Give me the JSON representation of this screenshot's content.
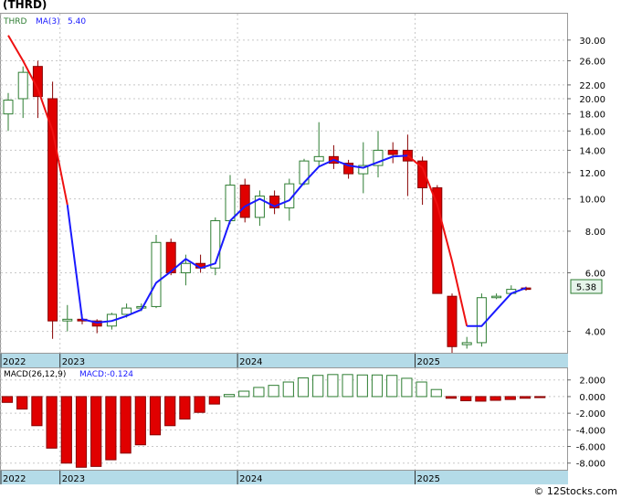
{
  "title": "(THRD)",
  "footer": "© 12Stocks.com",
  "colors": {
    "up": "#2e7d32",
    "down": "#e00000",
    "ma_up": "#1a1aff",
    "ma_down": "#ee1111",
    "axis_band": "#b4dbe8",
    "grid": "#c8c8c8",
    "price_box": "#e6f4ea"
  },
  "chart_data": [
    {
      "type": "candlestick",
      "scale": "log",
      "ylim": [
        3.45,
        36.0
      ],
      "grid": true,
      "legend": {
        "symbol": "THRD",
        "ma_label": "MA(3)",
        "ma_value": "5.40"
      },
      "last_price": "5.38",
      "yticks": [
        "30.00",
        "26.00",
        "22.00",
        "20.00",
        "18.00",
        "16.00",
        "14.00",
        "12.00",
        "10.00",
        "8.00",
        "6.00",
        "4.00"
      ],
      "xticks": [
        {
          "label": "2022",
          "month": "2022-09"
        },
        {
          "label": "2023",
          "month": "2023-01"
        },
        {
          "label": "2024",
          "month": "2024-01"
        },
        {
          "label": "2025",
          "month": "2025-01"
        }
      ],
      "months": [
        "2022-09",
        "2022-10",
        "2022-11",
        "2022-12",
        "2023-01",
        "2023-02",
        "2023-03",
        "2023-04",
        "2023-05",
        "2023-06",
        "2023-07",
        "2023-08",
        "2023-09",
        "2023-10",
        "2023-11",
        "2023-12",
        "2024-01",
        "2024-02",
        "2024-03",
        "2024-04",
        "2024-05",
        "2024-06",
        "2024-07",
        "2024-08",
        "2024-09",
        "2024-10",
        "2024-11",
        "2024-12",
        "2025-01",
        "2025-02",
        "2025-03",
        "2025-04",
        "2025-05",
        "2025-06",
        "2025-07",
        "2025-08"
      ],
      "ohlc": [
        [
          18.0,
          20.8,
          16.0,
          19.8
        ],
        [
          20.0,
          25.0,
          17.5,
          24.0
        ],
        [
          25.0,
          26.0,
          17.5,
          20.3
        ],
        [
          20.0,
          22.5,
          3.8,
          4.3
        ],
        [
          4.3,
          4.8,
          4.0,
          4.35
        ],
        [
          4.35,
          4.5,
          4.2,
          4.3
        ],
        [
          4.3,
          4.35,
          3.95,
          4.15
        ],
        [
          4.15,
          4.55,
          4.05,
          4.5
        ],
        [
          4.5,
          4.85,
          4.4,
          4.7
        ],
        [
          4.7,
          4.85,
          4.6,
          4.75
        ],
        [
          4.75,
          7.8,
          4.7,
          7.4
        ],
        [
          7.4,
          7.6,
          5.9,
          6.0
        ],
        [
          6.0,
          6.8,
          5.5,
          6.4
        ],
        [
          6.4,
          6.8,
          6.0,
          6.2
        ],
        [
          6.2,
          8.8,
          5.9,
          8.6
        ],
        [
          8.6,
          11.8,
          8.4,
          11.0
        ],
        [
          11.0,
          11.5,
          8.5,
          8.8
        ],
        [
          8.8,
          10.6,
          8.3,
          10.2
        ],
        [
          10.2,
          10.6,
          9.0,
          9.4
        ],
        [
          9.4,
          11.5,
          8.6,
          11.1
        ],
        [
          11.1,
          13.2,
          11.0,
          13.0
        ],
        [
          13.0,
          17.0,
          12.5,
          13.4
        ],
        [
          13.4,
          14.5,
          12.3,
          12.8
        ],
        [
          12.8,
          13.1,
          11.5,
          11.9
        ],
        [
          11.9,
          14.8,
          10.4,
          12.6
        ],
        [
          12.6,
          16.0,
          11.6,
          14.0
        ],
        [
          14.0,
          14.8,
          12.8,
          13.6
        ],
        [
          14.0,
          15.6,
          10.2,
          13.0
        ],
        [
          13.0,
          13.4,
          9.6,
          10.8
        ],
        [
          10.8,
          11.0,
          5.2,
          5.2
        ],
        [
          5.1,
          5.2,
          3.45,
          3.6
        ],
        [
          3.65,
          3.85,
          3.55,
          3.7
        ],
        [
          3.7,
          5.2,
          3.6,
          5.05
        ],
        [
          5.05,
          5.2,
          5.0,
          5.1
        ],
        [
          5.2,
          5.5,
          5.15,
          5.35
        ],
        [
          5.4,
          5.45,
          5.3,
          5.38
        ]
      ],
      "ma3": [
        31.0,
        26.0,
        21.4,
        16.0,
        9.6,
        4.35,
        4.25,
        4.3,
        4.45,
        4.65,
        5.6,
        6.05,
        6.6,
        6.2,
        6.4,
        8.6,
        9.5,
        10.0,
        9.5,
        9.9,
        11.2,
        12.5,
        13.1,
        12.6,
        12.4,
        12.9,
        13.4,
        13.5,
        12.4,
        9.6,
        6.5,
        4.15,
        4.15,
        4.65,
        5.2,
        5.4
      ],
      "series": [
        {
          "name": "THRD"
        },
        {
          "name": "MA(3)"
        }
      ]
    },
    {
      "type": "bar",
      "ylim": [
        -8.8,
        3.4
      ],
      "legend": {
        "label": "MACD(26,12,9)",
        "value_label": "MACD:-0.124"
      },
      "yticks": [
        "2.000",
        "0.000",
        "-2.000",
        "-4.000",
        "-6.000",
        "-8.000"
      ],
      "xticks": [
        {
          "label": "2022",
          "month": "2022-09"
        },
        {
          "label": "2023",
          "month": "2023-01"
        },
        {
          "label": "2024",
          "month": "2024-01"
        },
        {
          "label": "2025",
          "month": "2025-01"
        }
      ],
      "values": [
        -0.7,
        -1.5,
        -3.5,
        -6.2,
        -8.0,
        -8.5,
        -8.4,
        -7.6,
        -6.8,
        -5.8,
        -4.6,
        -3.5,
        -2.7,
        -1.9,
        -0.9,
        0.25,
        0.65,
        1.1,
        1.35,
        1.75,
        2.25,
        2.55,
        2.65,
        2.65,
        2.6,
        2.6,
        2.55,
        2.2,
        1.75,
        0.85,
        -0.2,
        -0.5,
        -0.55,
        -0.45,
        -0.35,
        -0.2,
        -0.124
      ],
      "series": [
        {
          "name": "MACD(26,12,9)"
        }
      ]
    }
  ]
}
